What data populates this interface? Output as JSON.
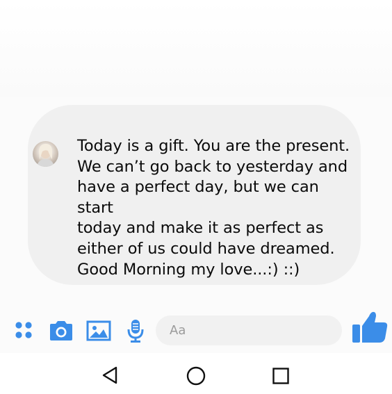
{
  "message": {
    "text": "Today is a gift. You are the present.\nWe can’t go back to yesterday and\nhave a perfect day, but we can start\ntoday and make it as perfect as\neither of us could have dreamed.\nGood Morning my love...:) ::)"
  },
  "composer": {
    "input_placeholder": "Aa",
    "icons": [
      "apps-icon",
      "camera-icon",
      "gallery-icon",
      "microphone-icon",
      "thumbs-up-icon"
    ]
  },
  "navbar": {
    "icons": [
      "back-icon",
      "home-icon",
      "recents-icon"
    ]
  },
  "colors": {
    "accent": "#3b8de8",
    "bubble": "#f0f0f0",
    "text": "#0a0a0a"
  }
}
